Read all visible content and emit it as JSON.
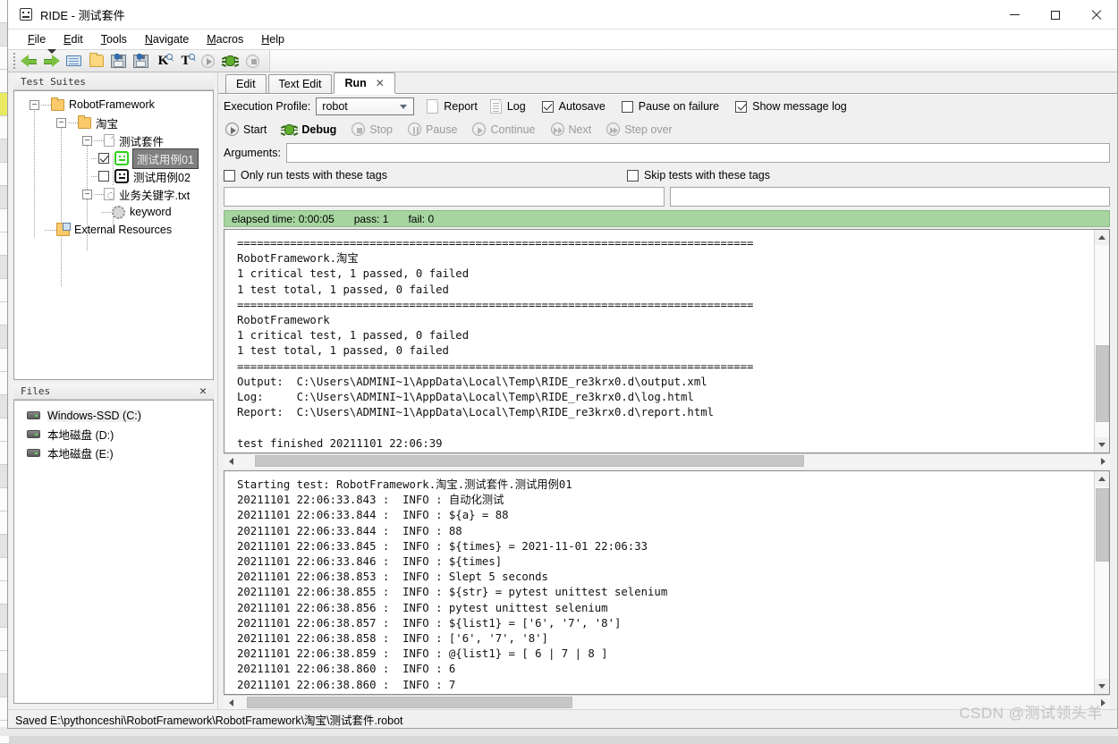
{
  "window": {
    "title": "RIDE - 测试套件",
    "minimize_label": "Minimize",
    "maximize_label": "Maximize",
    "close_label": "Close"
  },
  "menubar": [
    {
      "label": "File",
      "mnemonic": "F"
    },
    {
      "label": "Edit",
      "mnemonic": "E"
    },
    {
      "label": "Tools",
      "mnemonic": "T"
    },
    {
      "label": "Navigate",
      "mnemonic": "N"
    },
    {
      "label": "Macros",
      "mnemonic": "M"
    },
    {
      "label": "Help",
      "mnemonic": "H"
    }
  ],
  "toolbar": [
    {
      "name": "back",
      "tooltip": "Back"
    },
    {
      "name": "forward",
      "tooltip": "Forward"
    },
    {
      "name": "open",
      "tooltip": "Open"
    },
    {
      "name": "open-directory",
      "tooltip": "Open Directory"
    },
    {
      "name": "save",
      "tooltip": "Save"
    },
    {
      "name": "save-all",
      "tooltip": "Save All"
    },
    {
      "name": "search-keywords",
      "tooltip": "Search Keywords"
    },
    {
      "name": "search-tests",
      "tooltip": "Search Tests"
    },
    {
      "name": "run",
      "tooltip": "Run"
    },
    {
      "name": "debug",
      "tooltip": "Debug"
    },
    {
      "name": "stop",
      "tooltip": "Stop"
    }
  ],
  "tree_panel": {
    "caption": "Test Suites",
    "items": [
      {
        "label": "RobotFramework",
        "icon": "folder-icon",
        "depth": 0,
        "expander": "-"
      },
      {
        "label": "淘宝",
        "icon": "folder-icon",
        "depth": 1,
        "expander": "-"
      },
      {
        "label": "测试套件",
        "icon": "document-icon",
        "depth": 2,
        "expander": "-"
      },
      {
        "label": "测试用例01",
        "icon": "testcase-pass-icon",
        "depth": 3,
        "checkbox": "checked",
        "selected": true
      },
      {
        "label": "测试用例02",
        "icon": "testcase-icon",
        "depth": 3,
        "checkbox": "unchecked",
        "selected": false
      },
      {
        "label": "业务关键字.txt",
        "icon": "resource-icon",
        "depth": 2,
        "expander": "-"
      },
      {
        "label": "keyword",
        "icon": "gear-icon",
        "depth": 3
      },
      {
        "label": "External Resources",
        "icon": "external-resources-icon",
        "depth": 1
      }
    ]
  },
  "files_panel": {
    "caption": "Files",
    "close_label": "✕",
    "items": [
      {
        "label": "Windows-SSD (C:)",
        "icon": "drive-icon",
        "selected": true
      },
      {
        "label": "本地磁盘 (D:)",
        "icon": "drive-icon",
        "selected": false
      },
      {
        "label": "本地磁盘 (E:)",
        "icon": "drive-icon",
        "selected": false
      }
    ]
  },
  "tabs": [
    {
      "label": "Edit",
      "active": false,
      "closable": false
    },
    {
      "label": "Text Edit",
      "active": false,
      "closable": false
    },
    {
      "label": "Run",
      "active": true,
      "closable": true,
      "close_glyph": "✕"
    }
  ],
  "run_panel": {
    "profile_label": "Execution Profile:",
    "profile_value": "robot",
    "report_label": "Report",
    "log_label": "Log",
    "autosave_label": "Autosave",
    "autosave_checked": true,
    "pause_on_failure_label": "Pause on failure",
    "pause_on_failure_checked": false,
    "show_message_log_label": "Show message log",
    "show_message_log_checked": true,
    "controls": [
      {
        "label": "Start",
        "enabled": true,
        "icon": "play-icon"
      },
      {
        "label": "Debug",
        "enabled": true,
        "icon": "bug-icon"
      },
      {
        "label": "Stop",
        "enabled": false,
        "icon": "stop-icon"
      },
      {
        "label": "Pause",
        "enabled": false,
        "icon": "pause-icon"
      },
      {
        "label": "Continue",
        "enabled": false,
        "icon": "play-icon"
      },
      {
        "label": "Next",
        "enabled": false,
        "icon": "next-icon"
      },
      {
        "label": "Step over",
        "enabled": false,
        "icon": "step-over-icon"
      }
    ],
    "arguments_label": "Arguments:",
    "arguments_value": "",
    "only_run_tags_label": "Only run tests with these tags",
    "only_run_tags_checked": false,
    "only_run_tags_value": "",
    "skip_tags_label": "Skip tests with these tags",
    "skip_tags_checked": false,
    "skip_tags_value": ""
  },
  "status": {
    "elapsed": "elapsed time: 0:00:05",
    "pass": "pass: 1",
    "fail": "fail: 0",
    "background_color": "#a6d5a0"
  },
  "output_console": {
    "text": "==============================================================================\nRobotFramework.淘宝\n1 critical test, 1 passed, 0 failed\n1 test total, 1 passed, 0 failed\n==============================================================================\nRobotFramework\n1 critical test, 1 passed, 0 failed\n1 test total, 1 passed, 0 failed\n==============================================================================\nOutput:  C:\\Users\\ADMINI~1\\AppData\\Local\\Temp\\RIDE_re3krx0.d\\output.xml\nLog:     C:\\Users\\ADMINI~1\\AppData\\Local\\Temp\\RIDE_re3krx0.d\\log.html\nReport:  C:\\Users\\ADMINI~1\\AppData\\Local\\Temp\\RIDE_re3krx0.d\\report.html\n\ntest finished 20211101 22:06:39"
  },
  "message_log": {
    "text": "Starting test: RobotFramework.淘宝.测试套件.测试用例01\n20211101 22:06:33.843 :  INFO : 自动化测试\n20211101 22:06:33.844 :  INFO : ${a} = 88\n20211101 22:06:33.844 :  INFO : 88\n20211101 22:06:33.845 :  INFO : ${times} = 2021-11-01 22:06:33\n20211101 22:06:33.846 :  INFO : ${times]\n20211101 22:06:38.853 :  INFO : Slept 5 seconds\n20211101 22:06:38.855 :  INFO : ${str} = pytest unittest selenium\n20211101 22:06:38.856 :  INFO : pytest unittest selenium\n20211101 22:06:38.857 :  INFO : ${list1} = ['6', '7', '8']\n20211101 22:06:38.858 :  INFO : ['6', '7', '8']\n20211101 22:06:38.859 :  INFO : @{list1} = [ 6 | 7 | 8 ]\n20211101 22:06:38.860 :  INFO : 6\n20211101 22:06:38.860 :  INFO : 7"
  },
  "status_line": {
    "text": "Saved E:\\pythonceshi\\RobotFramework\\RobotFramework\\淘宝\\测试套件.robot"
  },
  "watermark": {
    "text": "CSDN @测试领头羊"
  }
}
